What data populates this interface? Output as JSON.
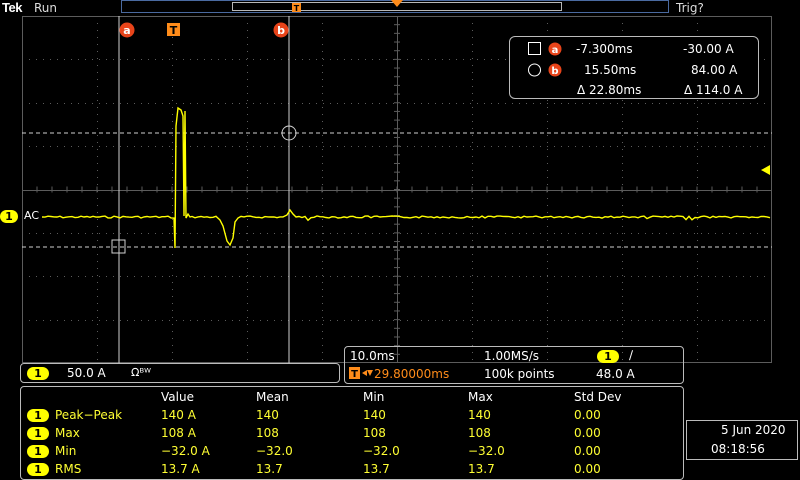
{
  "topbar": {
    "brand": "Tek",
    "run_state": "Run",
    "trigger_state": "Trig?"
  },
  "markers": {
    "cursor_a": "a",
    "cursor_b": "b",
    "trigger": "T"
  },
  "channel_marker": {
    "number": "1",
    "coupling": "AC"
  },
  "cursor_readout": {
    "row_a": {
      "time": "-7.300ms",
      "value": "-30.00 A"
    },
    "row_b": {
      "time": "15.50ms",
      "value": "84.00 A"
    },
    "delta": {
      "time": "Δ 22.80ms",
      "value": "Δ 114.0 A"
    }
  },
  "channel_readout": {
    "number": "1",
    "scale": "50.0 A",
    "bw_symbol": "Ωᴮᵂ"
  },
  "horizontal": {
    "time_div": "10.0ms",
    "sample_rate": "1.00MS/s",
    "trigger_position": "29.80000ms",
    "record_length": "100k points",
    "trig_channel": "1",
    "trig_slope": "∕",
    "trig_level": "48.0 A"
  },
  "measurements": {
    "headers": [
      "Value",
      "Mean",
      "Min",
      "Max",
      "Std Dev"
    ],
    "rows": [
      {
        "ch": "1",
        "name": "Peak−Peak",
        "value": "140 A",
        "mean": "140",
        "min": "140",
        "max": "140",
        "std": "0.00"
      },
      {
        "ch": "1",
        "name": "Max",
        "value": "108 A",
        "mean": "108",
        "min": "108",
        "max": "108",
        "std": "0.00"
      },
      {
        "ch": "1",
        "name": "Min",
        "value": "−32.0 A",
        "mean": "−32.0",
        "min": "−32.0",
        "max": "−32.0",
        "std": "0.00"
      },
      {
        "ch": "1",
        "name": "RMS",
        "value": "13.7 A",
        "mean": "13.7",
        "min": "13.7",
        "max": "13.7",
        "std": "0.00"
      }
    ]
  },
  "datetime": {
    "date": "5 Jun  2020",
    "time": "08:18:56"
  },
  "colors": {
    "trace": "#ffff00",
    "cursor_marker": "#e8441a",
    "trigger_marker": "#ff8c1a",
    "grid": "#5a5a5a"
  }
}
